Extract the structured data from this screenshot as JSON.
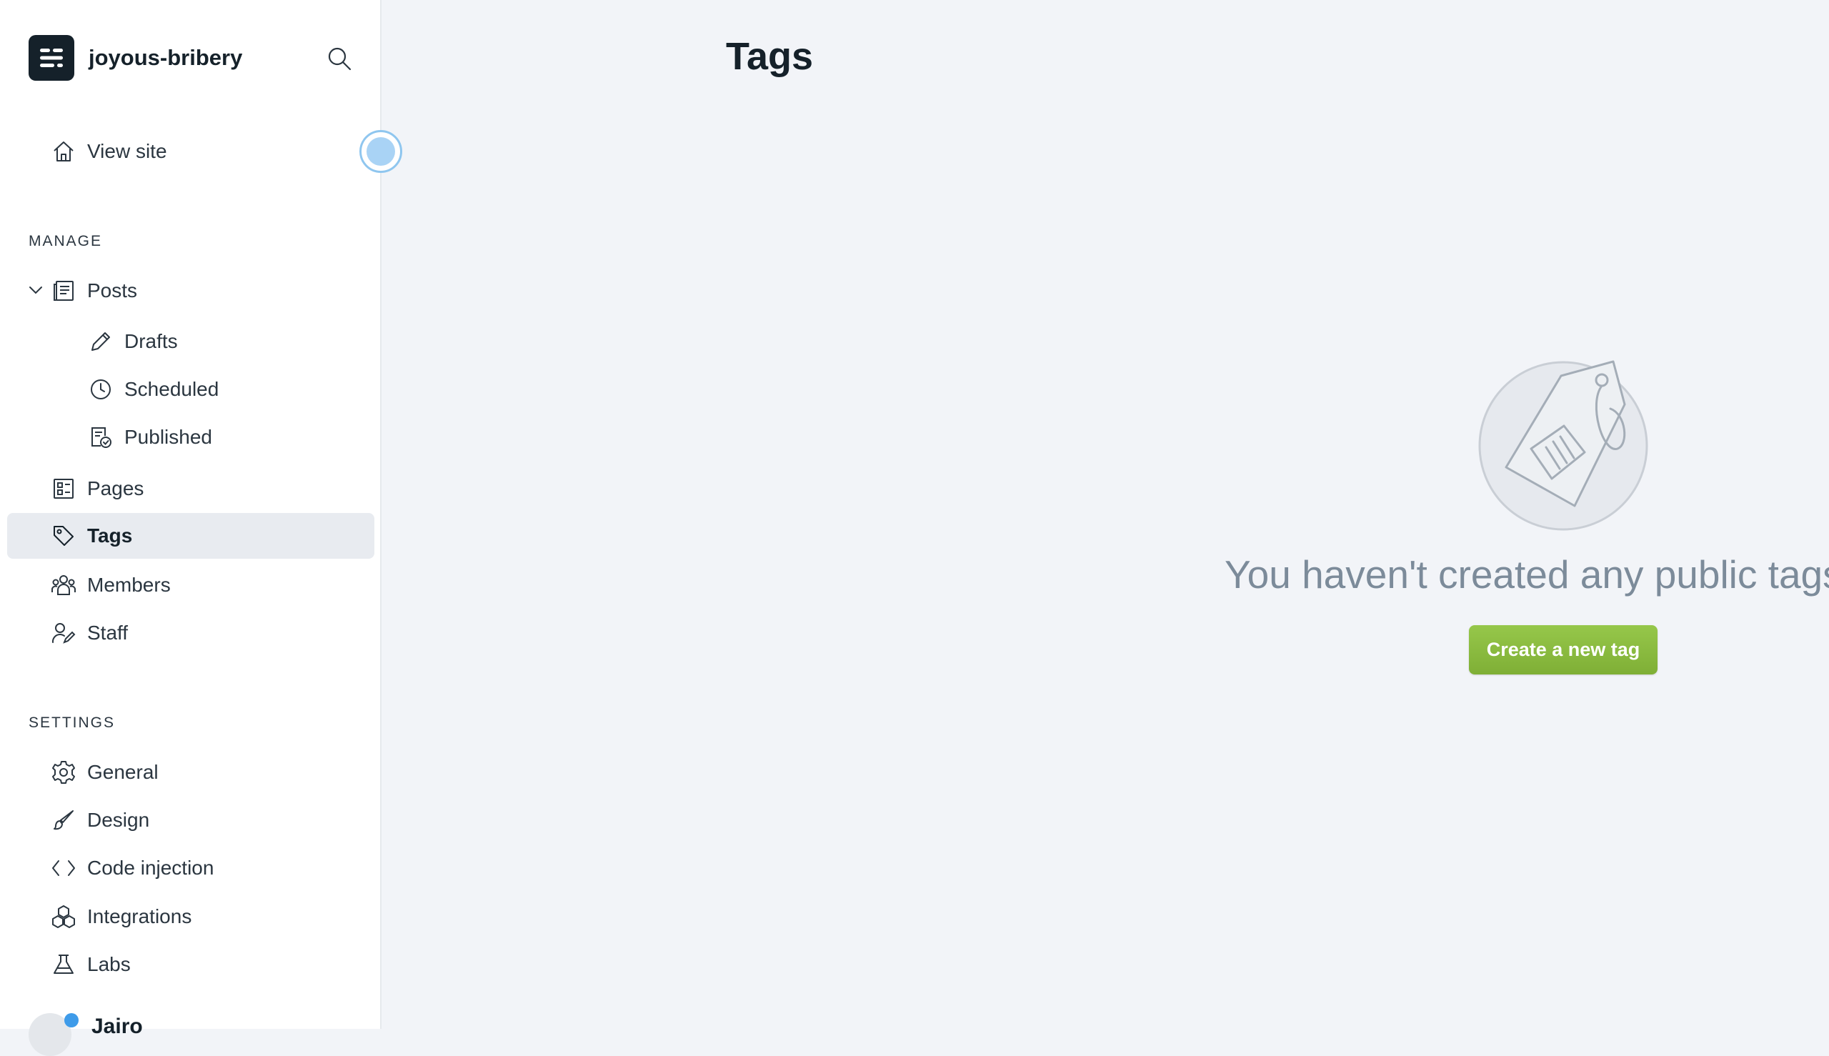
{
  "brand": {
    "site_name": "joyous-bribery"
  },
  "nav": {
    "view_site": "View site",
    "manage_label": "MANAGE",
    "posts": "Posts",
    "drafts": "Drafts",
    "scheduled": "Scheduled",
    "published": "Published",
    "pages": "Pages",
    "tags": "Tags",
    "members": "Members",
    "staff": "Staff",
    "settings_label": "SETTINGS",
    "general": "General",
    "design": "Design",
    "code_injection": "Code injection",
    "integrations": "Integrations",
    "labs": "Labs"
  },
  "user": {
    "name": "Jairo"
  },
  "main": {
    "title": "Tags",
    "empty_message": "You haven't created any public tags",
    "create_button": "Create a new tag"
  },
  "icons": {
    "brand": "ghost-logo-icon",
    "search": "search-icon",
    "view_site": "home-icon",
    "posts": "posts-icon",
    "drafts": "pencil-icon",
    "scheduled": "clock-icon",
    "published": "published-icon",
    "pages": "pages-icon",
    "tags": "tag-icon",
    "members": "members-icon",
    "staff": "staff-icon",
    "general": "gear-icon",
    "design": "brush-icon",
    "code_injection": "code-icon",
    "integrations": "integrations-icon",
    "labs": "flask-icon"
  },
  "colors": {
    "sidebar_bg": "#ffffff",
    "main_bg": "#f2f4f8",
    "active_item_bg": "#e8ebf0",
    "button_green": "#8fbf44",
    "empty_text": "#7c8b9a"
  }
}
